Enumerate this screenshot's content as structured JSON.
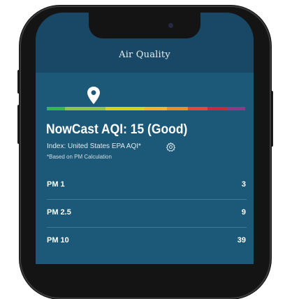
{
  "header": {
    "title": "Air Quality"
  },
  "icons": {
    "location": "location-pin-icon",
    "settings": "gear-icon"
  },
  "scale": {
    "colors": [
      "#39b54a",
      "#8dc63f",
      "#d4d21f",
      "#f4b42a",
      "#f08a24",
      "#e0483a",
      "#c72a3c",
      "#8e3a88"
    ]
  },
  "aqi": {
    "headline": "NowCast AQI: 15 (Good)",
    "index": "Index: United States EPA AQI*",
    "note": "*Based on PM Calculation"
  },
  "measurements": [
    {
      "label": "PM 1",
      "value": "3"
    },
    {
      "label": "PM 2.5",
      "value": "9"
    },
    {
      "label": "PM 10",
      "value": "39"
    }
  ]
}
